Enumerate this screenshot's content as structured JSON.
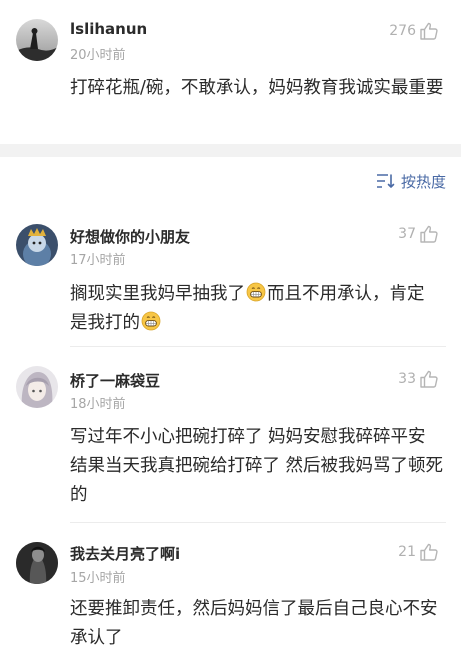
{
  "top_comment": {
    "username": "lslihanun",
    "time": "20小时前",
    "likes": "276",
    "text": "打碎花瓶/碗，不敢承认，妈妈教育我诚实最重要"
  },
  "sort": {
    "label": "按热度"
  },
  "comments": [
    {
      "username": "好想做你的小朋友",
      "time": "17小时前",
      "likes": "37",
      "text_part1": "搁现实里我妈早抽我了",
      "text_part2": "而且不用承认，肯定是我打的"
    },
    {
      "username": "桥了一麻袋豆",
      "time": "18小时前",
      "likes": "33",
      "text": "写过年不小心把碗打碎了 妈妈安慰我碎碎平安 结果当天我真把碗给打碎了 然后被我妈骂了顿死的"
    },
    {
      "username": "我去关月亮了啊i",
      "time": "15小时前",
      "likes": "21",
      "text": "还要推卸责任，然后妈妈信了最后自己良心不安承认了"
    }
  ],
  "colors": {
    "accent": "#4a6aa5",
    "meta": "#a6a6a6",
    "separator": "#f2f2f2"
  },
  "icons": [
    "thumbs-up-icon",
    "sort-icon",
    "grin-emoji"
  ]
}
